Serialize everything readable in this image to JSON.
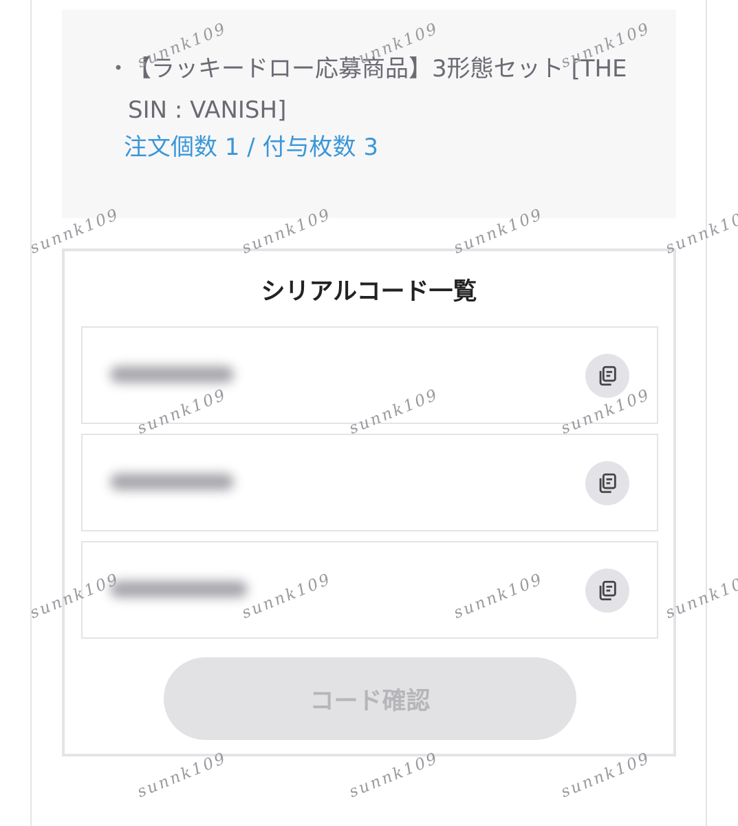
{
  "product": {
    "bullet": "・",
    "name": "【ラッキードロー応募商品】3形態セット [THE SIN : VANISH]",
    "order_info": "注文個数 1 / 付与枚数 3"
  },
  "serial_codes": {
    "title": "シリアルコード一覧",
    "rows": [
      {
        "code": "",
        "copy_icon": "copy-icon"
      },
      {
        "code": "",
        "copy_icon": "copy-icon"
      },
      {
        "code": "",
        "copy_icon": "copy-icon"
      }
    ],
    "confirm_label": "コード確認"
  },
  "watermark": "sunnk109",
  "colors": {
    "link_blue": "#3a97d8",
    "disabled_button": "#e2e2e4",
    "disabled_text": "#b6b6ba"
  }
}
